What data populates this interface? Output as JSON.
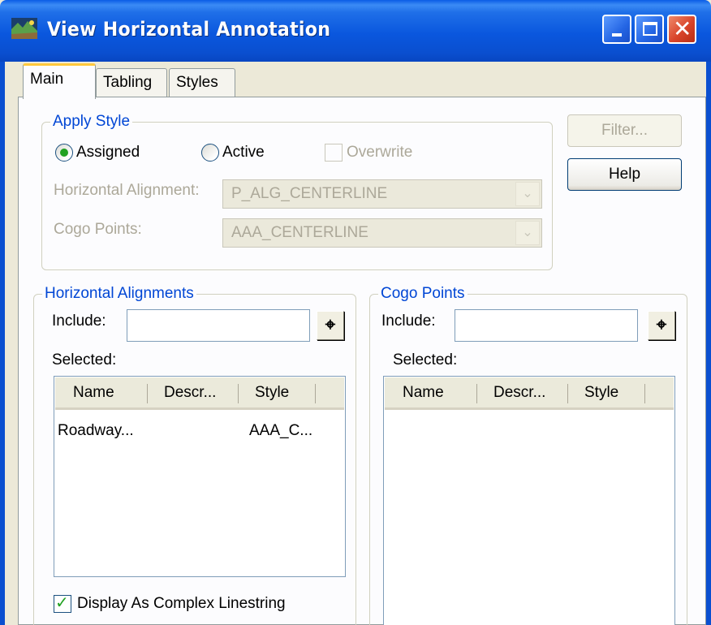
{
  "window": {
    "title": "View Horizontal Annotation"
  },
  "tabs": [
    {
      "label": "Main",
      "active": true
    },
    {
      "label": "Tabling",
      "active": false
    },
    {
      "label": "Styles",
      "active": false
    }
  ],
  "apply_style": {
    "legend": "Apply Style",
    "assigned_label": "Assigned",
    "assigned_selected": true,
    "active_label": "Active",
    "active_selected": false,
    "overwrite_label": "Overwrite",
    "overwrite_checked": false,
    "overwrite_enabled": false,
    "horizontal_alignment_label": "Horizontal Alignment:",
    "horizontal_alignment_value": "P_ALG_CENTERLINE",
    "cogo_points_label": "Cogo Points:",
    "cogo_points_value": "AAA_CENTERLINE"
  },
  "buttons": {
    "filter_label": "Filter...",
    "filter_enabled": false,
    "help_label": "Help"
  },
  "horizontal_alignments": {
    "legend": "Horizontal Alignments",
    "include_label": "Include:",
    "include_value": "",
    "pick_glyph": "⌖",
    "selected_label": "Selected:",
    "columns": [
      "Name",
      "Descr...",
      "Style"
    ],
    "rows": [
      {
        "name": "Roadway...",
        "description": "",
        "style": "AAA_C..."
      }
    ],
    "display_complex_label": "Display As Complex Linestring",
    "display_complex_checked": true
  },
  "cogo_points": {
    "legend": "Cogo Points",
    "include_label": "Include:",
    "include_value": "",
    "pick_glyph": "⌖",
    "selected_label": "Selected:",
    "columns": [
      "Name",
      "Descr...",
      "Style"
    ],
    "rows": []
  },
  "icons": {
    "minimize": "minimize-icon",
    "maximize": "maximize-icon",
    "close": "close-icon",
    "close_glyph": "✕",
    "checkmark_glyph": "✓",
    "dropdown_glyph": "⌄"
  },
  "colors": {
    "titlebar": "#0a57de",
    "group_legend": "#0046d5",
    "tab_highlight": "#ffc83c",
    "disabled_text": "#aca899"
  }
}
